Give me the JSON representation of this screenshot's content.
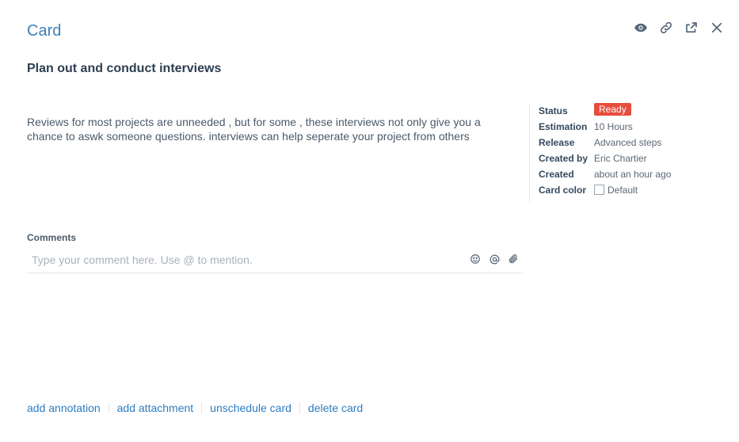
{
  "header": {
    "title": "Card",
    "icons": [
      "eye-icon",
      "link-icon",
      "share-icon",
      "close-icon"
    ]
  },
  "card": {
    "title": "Plan out and conduct interviews",
    "description": "Reviews for most projects are unneeded , but for some , these interviews not only give you a chance to aswk someone questions. interviews can help seperate your project from others"
  },
  "properties": {
    "status_label": "Status",
    "status_value": "Ready",
    "status_color": "#e74c3c",
    "estimation_label": "Estimation",
    "estimation_value": "10 Hours",
    "release_label": "Release",
    "release_value": "Advanced steps",
    "created_by_label": "Created by",
    "created_by_value": "Eric Chartier",
    "created_label": "Created",
    "created_value": "about an hour ago",
    "card_color_label": "Card color",
    "card_color_value": "Default"
  },
  "comments": {
    "label": "Comments",
    "placeholder": "Type your comment here. Use @ to mention."
  },
  "footer": {
    "add_annotation": "add annotation",
    "add_attachment": "add attachment",
    "unschedule_card": "unschedule card",
    "delete_card": "delete card"
  },
  "colors": {
    "accent": "#3d7fb8",
    "link": "#2d7cc2"
  }
}
